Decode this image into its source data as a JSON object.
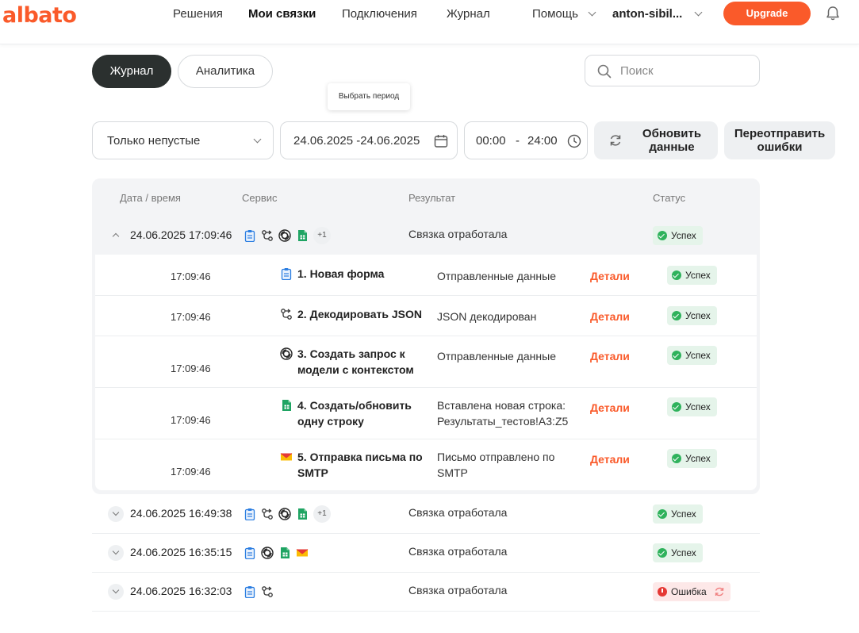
{
  "header": {
    "logo": "albato",
    "nav": [
      "Решения",
      "Мои связки",
      "Подключения",
      "Журнал"
    ],
    "help": "Помощь",
    "user": "anton-sibil...",
    "upgrade": "Upgrade"
  },
  "tabs": {
    "journal": "Журнал",
    "analytics": "Аналитика"
  },
  "search": {
    "placeholder": "Поиск"
  },
  "tooltip": "Выбрать период",
  "filters": {
    "only_nonempty": "Только непустые",
    "date_range": "24.06.2025 -24.06.2025",
    "time_from": "00:00",
    "time_dash": "-",
    "time_to": "24:00",
    "refresh_line1": "Обновить",
    "refresh_line2": "данные",
    "resend_line1": "Переотправить",
    "resend_line2": "ошибки"
  },
  "table": {
    "headers": {
      "datetime": "Дата / время",
      "service": "Сервис",
      "result": "Результат",
      "status": "Статус"
    },
    "rows": [
      {
        "datetime": "24.06.2025 17:09:46",
        "result": "Связка отработала",
        "status": "Успех",
        "more": "+1"
      },
      {
        "datetime": "24.06.2025 16:49:38",
        "result": "Связка отработала",
        "status": "Успех",
        "more": "+1"
      },
      {
        "datetime": "24.06.2025 16:35:15",
        "result": "Связка отработала",
        "status": "Успех"
      },
      {
        "datetime": "24.06.2025 16:32:03",
        "result": "Связка отработала",
        "status": "Ошибка"
      }
    ],
    "steps": [
      {
        "time": "17:09:46",
        "name": "1. Новая форма",
        "result": "Отправленные данные",
        "details": "Детали",
        "status": "Успех",
        "icon": "form-icon"
      },
      {
        "time": "17:09:46",
        "name": "2. Декодировать JSON",
        "result": "JSON декодирован",
        "details": "Детали",
        "status": "Успех",
        "icon": "json-tool-icon"
      },
      {
        "time": "17:09:46",
        "name": "3. Создать запрос к модели с контекстом",
        "result": "Отправленные данные",
        "details": "Детали",
        "status": "Успех",
        "icon": "openai-icon"
      },
      {
        "time": "17:09:46",
        "name": "4. Создать/обновить одну строку",
        "result": "Вставлена новая строка: Результаты_тестов!A3:Z5",
        "details": "Детали",
        "status": "Успех",
        "icon": "google-sheets-icon"
      },
      {
        "time": "17:09:46",
        "name": "5. Отправка письма по SMTP",
        "result": "Письмо отправлено по SMTP",
        "details": "Детали",
        "status": "Успех",
        "icon": "mail-icon"
      }
    ]
  },
  "colors": {
    "accent": "#fa5a2a",
    "success": "#2fb25c",
    "error": "#e53935",
    "dark": "#2b302f"
  }
}
